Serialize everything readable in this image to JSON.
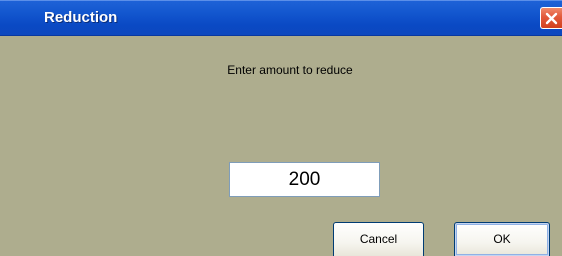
{
  "window": {
    "title": "Reduction",
    "close_icon": "close-icon"
  },
  "dialog": {
    "prompt": "Enter amount to reduce",
    "amount_value": "200"
  },
  "buttons": {
    "cancel_label": "Cancel",
    "ok_label": "OK"
  },
  "colors": {
    "titlebar": "#0a49c4",
    "dialog_background": "#aead8e",
    "close_button": "#e2593a"
  }
}
